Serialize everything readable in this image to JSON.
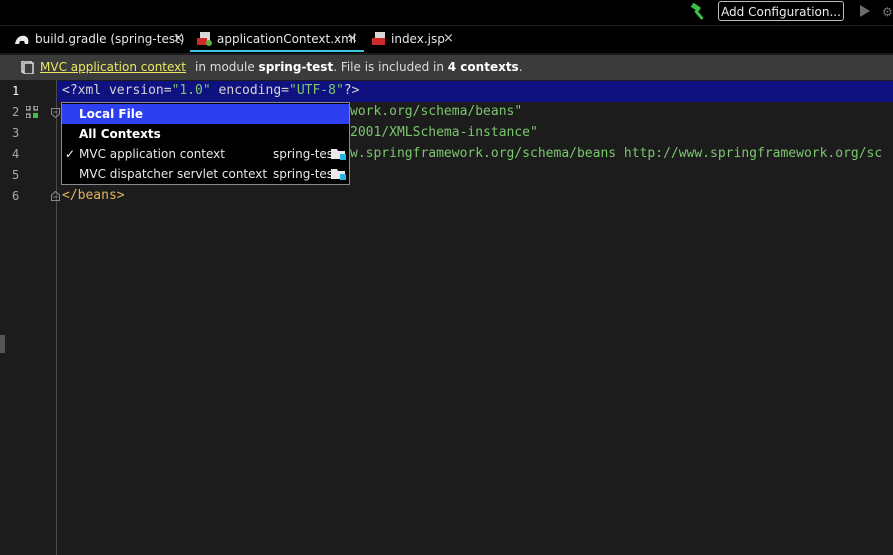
{
  "toolbar": {
    "hammer_icon": "hammer-icon",
    "add_configuration": "Add Configuration...",
    "run_icon": "run-icon"
  },
  "tabs": [
    {
      "label": "build.gradle (spring-test)",
      "icon": "gradle-icon",
      "close": "×",
      "active": false
    },
    {
      "label": "applicationContext.xml",
      "icon": "xml-spring-icon",
      "close": "×",
      "active": true
    },
    {
      "label": "index.jsp",
      "icon": "jsp-icon",
      "close": "×",
      "active": false
    }
  ],
  "banner": {
    "link": "MVC application context",
    "prefix": "in module ",
    "module": "spring-test",
    "middle": ". File is included in ",
    "count": "4 contexts",
    "suffix": "."
  },
  "editor": {
    "line_numbers": [
      "1",
      "2",
      "3",
      "4",
      "5",
      "6"
    ],
    "line1": {
      "p1": "<?xml version=",
      "v1": "\"1.0\"",
      "p2": " encoding=",
      "v2": "\"UTF-8\"",
      "p3": "?>"
    },
    "line2_tail": "work.org/schema/beans\"",
    "line3_tail": "2001/XMLSchema-instance\"",
    "line4_tail": "w.springframework.org/schema/beans http://www.springframework.org/sc",
    "line6": "</beans>"
  },
  "context_popup": {
    "items": [
      {
        "label": "Local File",
        "bold": true,
        "selected": true,
        "checked": false,
        "module": ""
      },
      {
        "label": "All Contexts",
        "bold": true,
        "selected": false,
        "checked": false,
        "module": ""
      },
      {
        "label": "MVC application context",
        "bold": false,
        "selected": false,
        "checked": true,
        "module": "spring-test"
      },
      {
        "label": "MVC dispatcher servlet context",
        "bold": false,
        "selected": false,
        "checked": false,
        "module": "spring-test"
      }
    ],
    "check_glyph": "✓"
  },
  "colors": {
    "accent_tab": "#3ec6e0",
    "selection": "#2e3ff0",
    "current_line": "#0f1180",
    "banner_link": "#e9e965",
    "string": "#7bc66e",
    "tag": "#e3b35a"
  }
}
